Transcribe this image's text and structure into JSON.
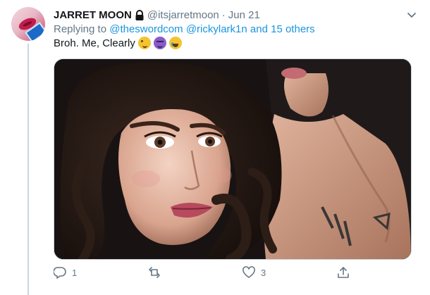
{
  "tweet": {
    "display_name": "JARRET MOON",
    "handle": "@itsjarretmoon",
    "separator": "·",
    "date": "Jun 21",
    "replying_prefix": "Replying to",
    "mention_1": "@theswordcom",
    "mention_2": "@rickylark1n",
    "mention_others": "and 15 others",
    "text": "Broh. Me, Clearly",
    "emojis": [
      "winking-face-emoji",
      "smiling-devil-emoji",
      "tears-of-joy-emoji"
    ]
  },
  "actions": {
    "reply_count": "1",
    "retweet_count": "",
    "like_count": "3"
  },
  "icons": {
    "lock": "lock-icon",
    "caret": "chevron-down-icon",
    "reply": "reply-icon",
    "retweet": "retweet-icon",
    "like": "heart-icon",
    "share": "share-icon"
  },
  "colors": {
    "link": "#1b95e0",
    "secondary_text": "#657786",
    "primary_text": "#14171a",
    "border": "#ccd6dd"
  }
}
